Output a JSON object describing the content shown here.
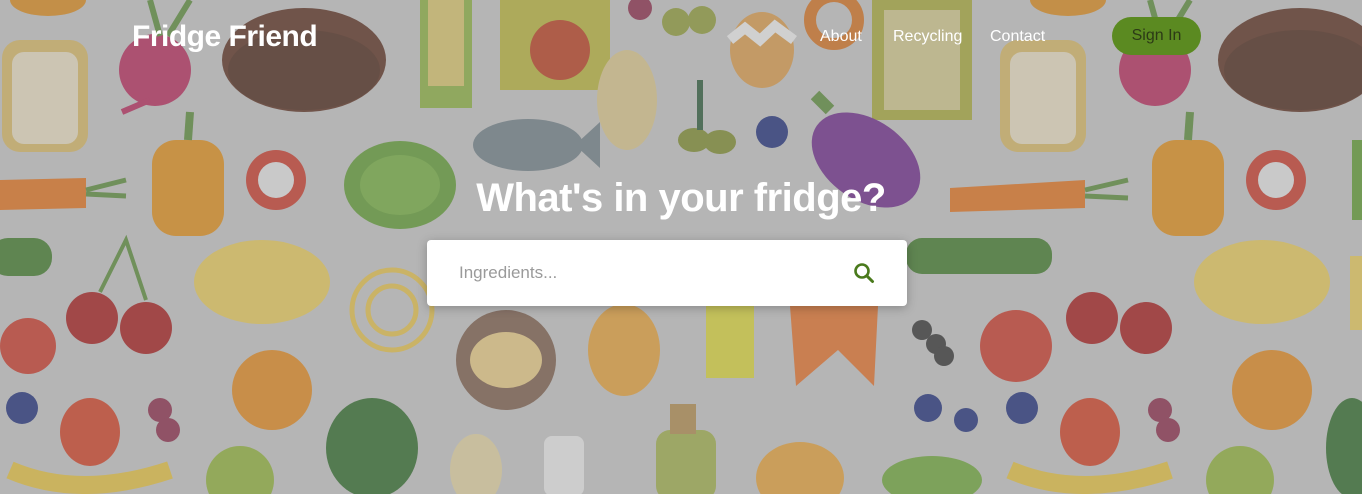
{
  "nav": {
    "brand": "Fridge Friend",
    "links": [
      "About",
      "Recycling",
      "Contact"
    ],
    "sign_in": "Sign In"
  },
  "hero": {
    "title": "What's in your fridge?",
    "search_placeholder": "Ingredients..."
  },
  "colors": {
    "accent": "#5b8a21",
    "search_icon": "#4a7a1c",
    "background": "#b9b9b9"
  },
  "icons": [
    "search-icon"
  ]
}
